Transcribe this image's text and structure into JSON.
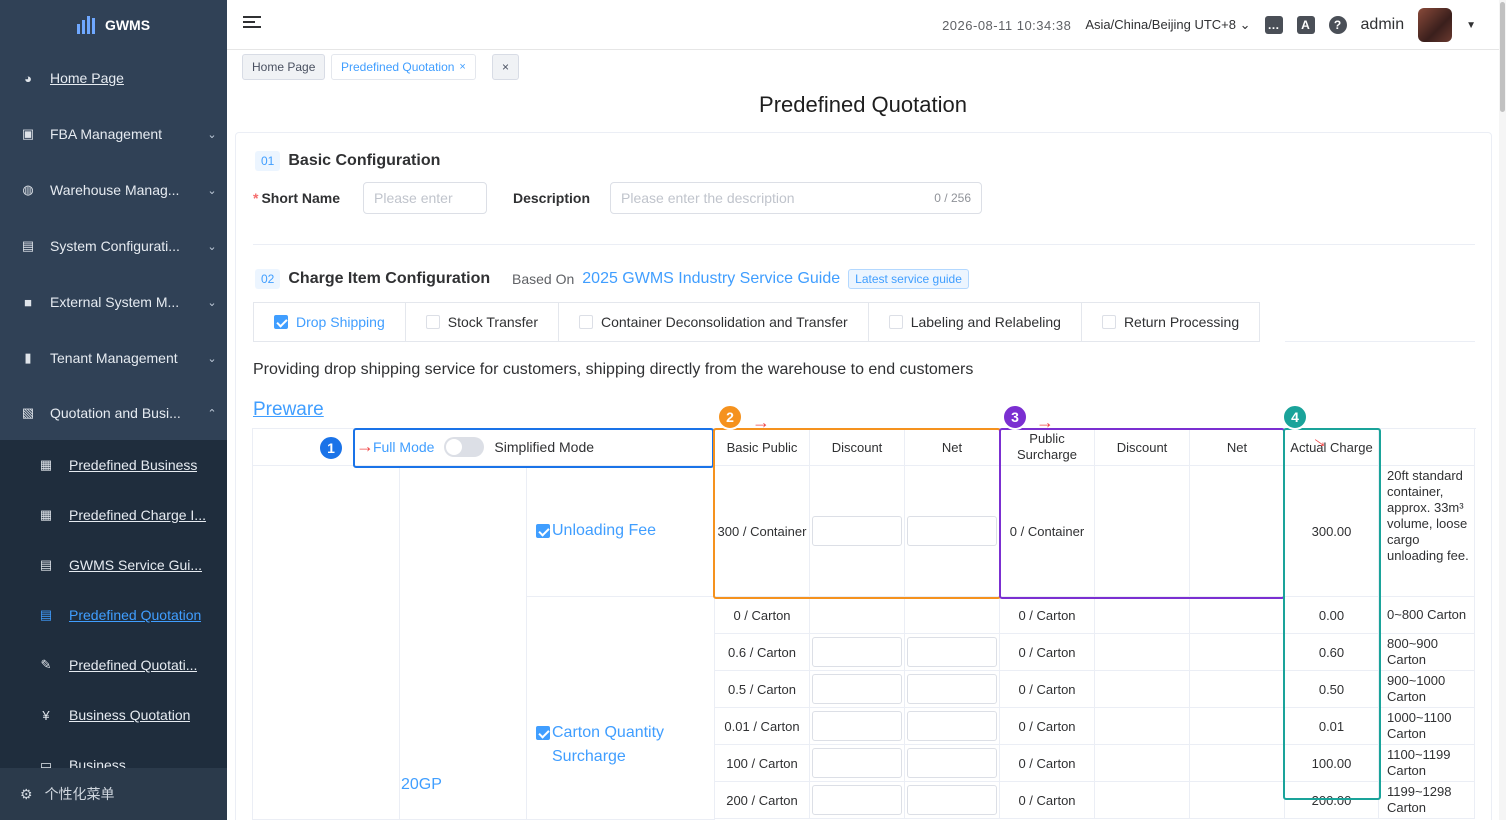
{
  "app": {
    "name": "GWMS"
  },
  "sidebar": {
    "items": [
      {
        "label": "Home Page",
        "icon": "dashboard-icon",
        "arrow": ""
      },
      {
        "label": "FBA Management",
        "icon": "box-icon",
        "arrow": "⌄"
      },
      {
        "label": "Warehouse Manag...",
        "icon": "globe-icon",
        "arrow": "⌄"
      },
      {
        "label": "System Configurati...",
        "icon": "settings-icon",
        "arrow": "⌄"
      },
      {
        "label": "External System M...",
        "icon": "grid-icon",
        "arrow": "⌄"
      },
      {
        "label": "Tenant Management",
        "icon": "chart-icon",
        "arrow": "⌄"
      },
      {
        "label": "Quotation and Busi...",
        "icon": "quotation-icon",
        "arrow": "⌃"
      }
    ],
    "subitems": [
      {
        "label": "Predefined Business",
        "icon": "calendar-icon"
      },
      {
        "label": "Predefined Charge I...",
        "icon": "table-icon"
      },
      {
        "label": "GWMS Service Gui...",
        "icon": "document-icon"
      },
      {
        "label": "Predefined Quotation",
        "icon": "document-icon"
      },
      {
        "label": "Predefined Quotati...",
        "icon": "edit-icon"
      },
      {
        "label": "Business Quotation",
        "icon": "yen-icon"
      },
      {
        "label": "Business",
        "icon": "folder-icon"
      }
    ],
    "footer": "个性化菜单"
  },
  "header": {
    "datetime": "2026-08-11 10:34:38",
    "timezone": "Asia/China/Beijing UTC+8",
    "user": "admin"
  },
  "tags": {
    "home": "Home Page",
    "active": "Predefined Quotation",
    "close": "×"
  },
  "page": {
    "title": "Predefined Quotation"
  },
  "basic": {
    "num": "01",
    "title": "Basic Configuration",
    "short_name_label": "Short Name",
    "short_name_placeholder": "Please enter",
    "description_label": "Description",
    "description_placeholder": "Please enter the description",
    "description_count": "0 / 256"
  },
  "charge": {
    "num": "02",
    "title": "Charge Item Configuration",
    "based_on_label": "Based On",
    "guide": "2025 GWMS Industry Service Guide",
    "guide_badge": "Latest service guide",
    "tabs": [
      {
        "label": "Drop Shipping",
        "checked": true
      },
      {
        "label": "Stock Transfer",
        "checked": false
      },
      {
        "label": "Container Deconsolidation and Transfer",
        "checked": false
      },
      {
        "label": "Labeling and Relabeling",
        "checked": false
      },
      {
        "label": "Return Processing",
        "checked": false
      }
    ],
    "description": "Providing drop shipping service for customers, shipping directly from the warehouse to end customers",
    "link": "Preware",
    "mode_full": "Full Mode",
    "mode_simplified": "Simplified Mode",
    "columns": [
      "Basic Public",
      "Discount",
      "Net",
      "Public Surcharge",
      "Discount",
      "Net",
      "Actual Charge"
    ],
    "container_type": "20GP",
    "fee1": {
      "label": "Unloading Fee",
      "basic": "300 / Container",
      "surcharge": "0 / Container",
      "actual": "300.00",
      "remark": "20ft standard container, approx. 33m³ volume, loose cargo unloading fee."
    },
    "fee2": {
      "label": "Carton Quantity Surcharge",
      "rows": [
        {
          "basic": "0 / Carton",
          "surcharge": "0 / Carton",
          "actual": "0.00",
          "remark": "0~800 Carton"
        },
        {
          "basic": "0.6 / Carton",
          "surcharge": "0 / Carton",
          "actual": "0.60",
          "remark": "800~900 Carton"
        },
        {
          "basic": "0.5 / Carton",
          "surcharge": "0 / Carton",
          "actual": "0.50",
          "remark": "900~1000 Carton"
        },
        {
          "basic": "0.01 / Carton",
          "surcharge": "0 / Carton",
          "actual": "0.01",
          "remark": "1000~1100 Carton"
        },
        {
          "basic": "100 / Carton",
          "surcharge": "0 / Carton",
          "actual": "100.00",
          "remark": "1100~1199 Carton"
        },
        {
          "basic": "200 / Carton",
          "surcharge": "0 / Carton",
          "actual": "200.00",
          "remark": "1199~1298 Carton"
        }
      ]
    }
  },
  "annotations": [
    {
      "num": "1",
      "color": "#1a73e8"
    },
    {
      "num": "2",
      "color": "#f5921e"
    },
    {
      "num": "3",
      "color": "#7b2fd1"
    },
    {
      "num": "4",
      "color": "#1aa39a"
    }
  ]
}
